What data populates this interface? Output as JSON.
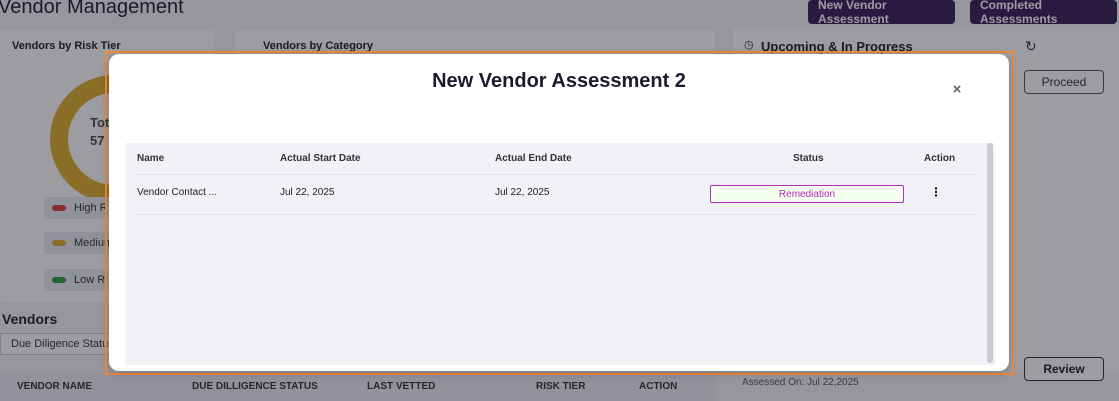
{
  "app": {
    "title": "Vendor Management",
    "buttons": {
      "new_assessment": "New Vendor Assessment",
      "completed_assessments": "Completed Assessments"
    }
  },
  "cards": {
    "risk_tier": {
      "title": "Vendors by Risk Tier",
      "donut_label": "Tot",
      "donut_value": "57",
      "legend": [
        {
          "label": "High R",
          "color": "#d64545"
        },
        {
          "label": "Medium",
          "color": "#e0b02e"
        },
        {
          "label": "Low Ri",
          "color": "#2fa04a"
        }
      ]
    },
    "category": {
      "title": "Vendors by Category"
    },
    "upcoming": {
      "title": "Upcoming & In Progress",
      "proceed_label": "Proceed",
      "review_label": "Review",
      "assessed_on": "Assessed On: Jul 22,2025"
    }
  },
  "vendors": {
    "title": "Vendors",
    "filter_value": "Due Diligence Statu",
    "columns": [
      "VENDOR NAME",
      "DUE DILLIGENCE STATUS",
      "LAST VETTED",
      "RISK TIER",
      "ACTION"
    ]
  },
  "modal": {
    "title": "New Vendor Assessment 2",
    "close": "×",
    "columns": {
      "name": "Name",
      "start": "Actual Start Date",
      "end": "Actual End Date",
      "status": "Status",
      "action": "Action"
    },
    "rows": [
      {
        "name": "Vendor Contact ...",
        "start": "Jul 22, 2025",
        "end": "Jul 22, 2025",
        "status": "Remediation",
        "action_icon": "⋮"
      }
    ],
    "colors": {
      "status_border": "#b52bb7",
      "status_bg": "#f4fff0"
    }
  }
}
